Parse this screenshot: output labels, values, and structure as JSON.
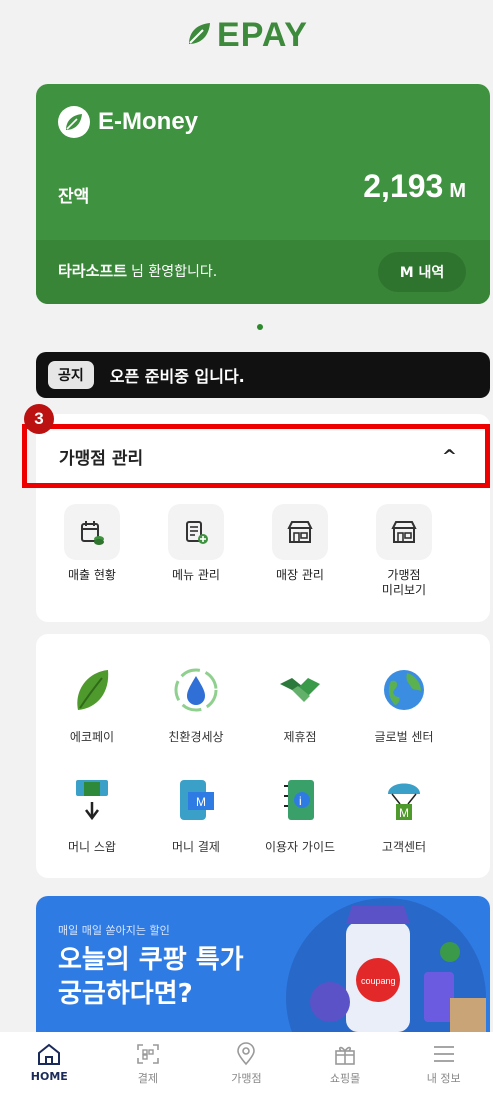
{
  "app": {
    "brand": "EPAY"
  },
  "emoney": {
    "title": "E-Money",
    "balance_label": "잔액",
    "balance_value": "2,193",
    "balance_unit": "M",
    "user_name": "타라소프트",
    "welcome_suffix": "님 환영합니다.",
    "history_button": "M 내역"
  },
  "notice": {
    "tag": "공지",
    "message": "오픈 준비중 입니다."
  },
  "store_management": {
    "badge": "3",
    "title": "가맹점 관리",
    "items": [
      {
        "label": "매출 현황",
        "icon": "sales-calendar-icon"
      },
      {
        "label": "메뉴 관리",
        "icon": "menu-document-icon"
      },
      {
        "label": "매장 관리",
        "icon": "store-icon"
      },
      {
        "label": "가맹점\n미리보기",
        "icon": "store-preview-icon"
      }
    ]
  },
  "services": {
    "row1": [
      {
        "label": "에코페이",
        "icon": "leaf-icon"
      },
      {
        "label": "친환경세상",
        "icon": "water-drop-icon"
      },
      {
        "label": "제휴점",
        "icon": "handshake-icon"
      },
      {
        "label": "글로벌 센터",
        "icon": "globe-icon"
      }
    ],
    "row2": [
      {
        "label": "머니 스왑",
        "icon": "money-swap-icon"
      },
      {
        "label": "머니 결제",
        "icon": "money-payment-icon"
      },
      {
        "label": "이용자 가이드",
        "icon": "user-guide-icon"
      },
      {
        "label": "고객센터",
        "icon": "customer-center-icon"
      }
    ]
  },
  "banner": {
    "subtitle": "매일 매일 쏟아지는 할인",
    "headline": "오늘의 쿠팡 특가\n궁금하다면?",
    "logo_text": "coupang"
  },
  "tabbar": [
    {
      "label": "HOME",
      "icon": "home-icon",
      "active": true
    },
    {
      "label": "결제",
      "icon": "qr-scan-icon"
    },
    {
      "label": "가맹점",
      "icon": "location-pin-icon"
    },
    {
      "label": "쇼핑몰",
      "icon": "gift-icon"
    },
    {
      "label": "내 정보",
      "icon": "menu-icon"
    }
  ],
  "colors": {
    "primary_green": "#3f923f",
    "highlight_red": "#e00000",
    "banner_blue": "#2f7be4"
  }
}
